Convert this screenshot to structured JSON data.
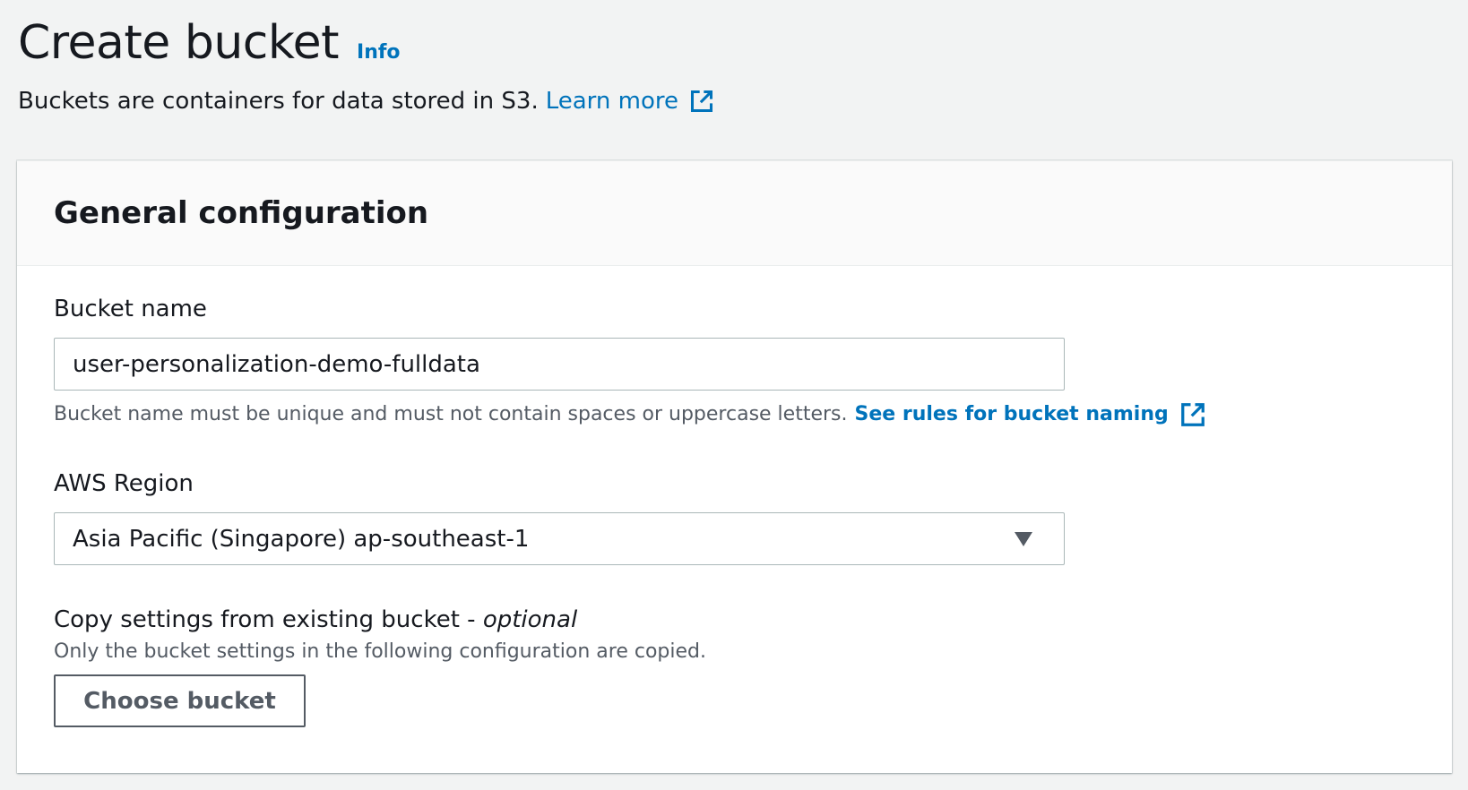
{
  "header": {
    "title": "Create bucket",
    "info_label": "Info",
    "description": "Buckets are containers for data stored in S3.",
    "learn_more_label": "Learn more"
  },
  "general": {
    "title": "General configuration",
    "bucket_name": {
      "label": "Bucket name",
      "value": "user-personalization-demo-fulldata",
      "constraint": "Bucket name must be unique and must not contain spaces or uppercase letters.",
      "rules_link": "See rules for bucket naming"
    },
    "region": {
      "label": "AWS Region",
      "selected": "Asia Pacific (Singapore) ap-southeast-1"
    },
    "copy_settings": {
      "label": "Copy settings from existing bucket - ",
      "optional": "optional",
      "description": "Only the bucket settings in the following configuration are copied.",
      "button_label": "Choose bucket"
    }
  },
  "colors": {
    "link": "#0073bb",
    "page_background": "#f2f3f3",
    "text": "#16191f",
    "secondary_text": "#545b64"
  },
  "icons": [
    "external-link-icon",
    "caret-down-icon"
  ]
}
